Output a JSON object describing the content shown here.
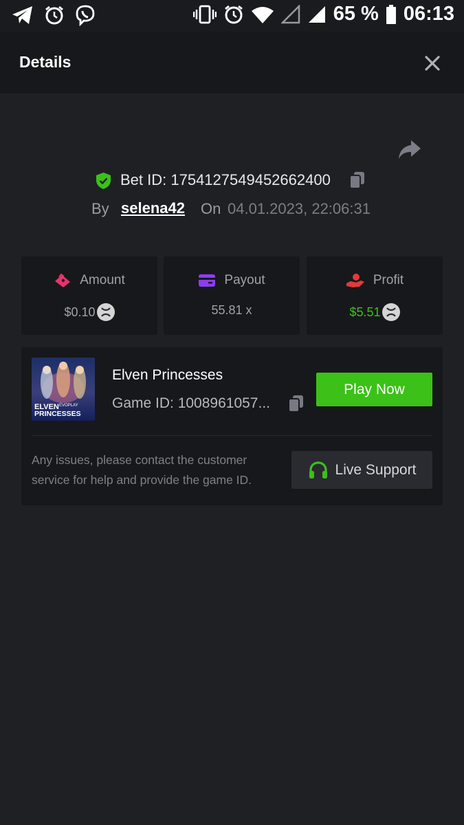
{
  "status_bar": {
    "battery": "65 %",
    "time": "06:13"
  },
  "header": {
    "title": "Details"
  },
  "bet": {
    "id_text": "Bet ID: 1754127549452662400",
    "by_label": "By",
    "username": "selena42",
    "on_label": "On",
    "datetime": "04.01.2023, 22:06:31"
  },
  "stats": {
    "amount_label": "Amount",
    "amount_value": "$0.10",
    "payout_label": "Payout",
    "payout_value": "55.81 x",
    "profit_label": "Profit",
    "profit_value": "$5.51"
  },
  "game": {
    "name": "Elven Princesses",
    "id_text": "Game ID: 1008961057...",
    "thumb_line1": "ELVEN",
    "thumb_brand": "EVOPLAY",
    "thumb_line2": "PRINCESSES",
    "play_label": "Play Now",
    "issues_text": "Any issues, please contact the customer service for help and provide the game ID.",
    "support_label": "Live Support"
  },
  "colors": {
    "background": "#1f2024",
    "card": "#17181b",
    "accent_green": "#3bc117",
    "profit_green": "#3bc117",
    "amount_pink": "#e8336d",
    "payout_purple": "#8b3df0",
    "profit_red": "#e23a3a"
  }
}
